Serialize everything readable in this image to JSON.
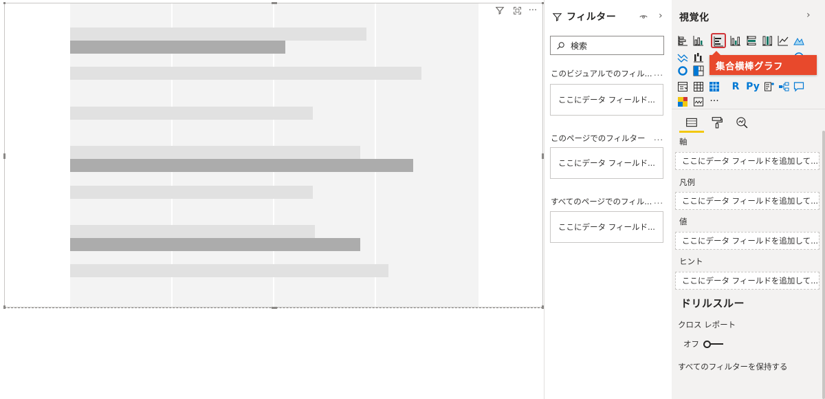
{
  "canvas": {
    "chart_data": {
      "type": "bar",
      "orientation": "horizontal",
      "series": [
        {
          "values": [
            0.725,
            0.86,
            0.595,
            0.71,
            0.595,
            0.6,
            0.78
          ]
        },
        {
          "values": [
            0.527,
            null,
            null,
            0.84,
            null,
            0.71,
            null
          ]
        }
      ],
      "title": "",
      "xlabel": "",
      "ylabel": "",
      "grid": true
    },
    "colors": {
      "plot_bg": "#f3f3f3",
      "bar_light": "#e1e1e1",
      "bar_dark": "#acacac"
    },
    "visual_icons": [
      "filter-icon",
      "focus-mode-icon",
      "more-options-icon"
    ],
    "more_glyph": "···"
  },
  "filter_pane": {
    "title": "フィルター",
    "search_placeholder": "検索",
    "sections": [
      {
        "label": "このビジュアルでのフィル...",
        "more": "...",
        "well": "ここにデータ フィールド..."
      },
      {
        "label": "このページでのフィルター",
        "more": "...",
        "well": "ここにデータ フィールド..."
      },
      {
        "label": "すべてのページでのフィル...",
        "more": "...",
        "well": "ここにデータ フィールド..."
      }
    ]
  },
  "viz_pane": {
    "title": "視覚化",
    "tooltip": "集合横棒グラフ",
    "r_label": "R",
    "py_label": "Py",
    "more_glyph": "···",
    "wells": [
      {
        "label": "軸",
        "placeholder": "ここにデータ フィールドを追加して..."
      },
      {
        "label": "凡例",
        "placeholder": "ここにデータ フィールドを追加して..."
      },
      {
        "label": "値",
        "placeholder": "ここにデータ フィールドを追加して..."
      },
      {
        "label": "ヒント",
        "placeholder": "ここにデータ フィールドを追加して..."
      }
    ],
    "drillthrough": {
      "title": "ドリルスルー",
      "cross_report": "クロス レポート",
      "toggle_label": "オフ",
      "keep_filters": "すべてのフィルターを保持する"
    },
    "accent": "#f2c811",
    "tooltip_color": "#e8492c"
  }
}
